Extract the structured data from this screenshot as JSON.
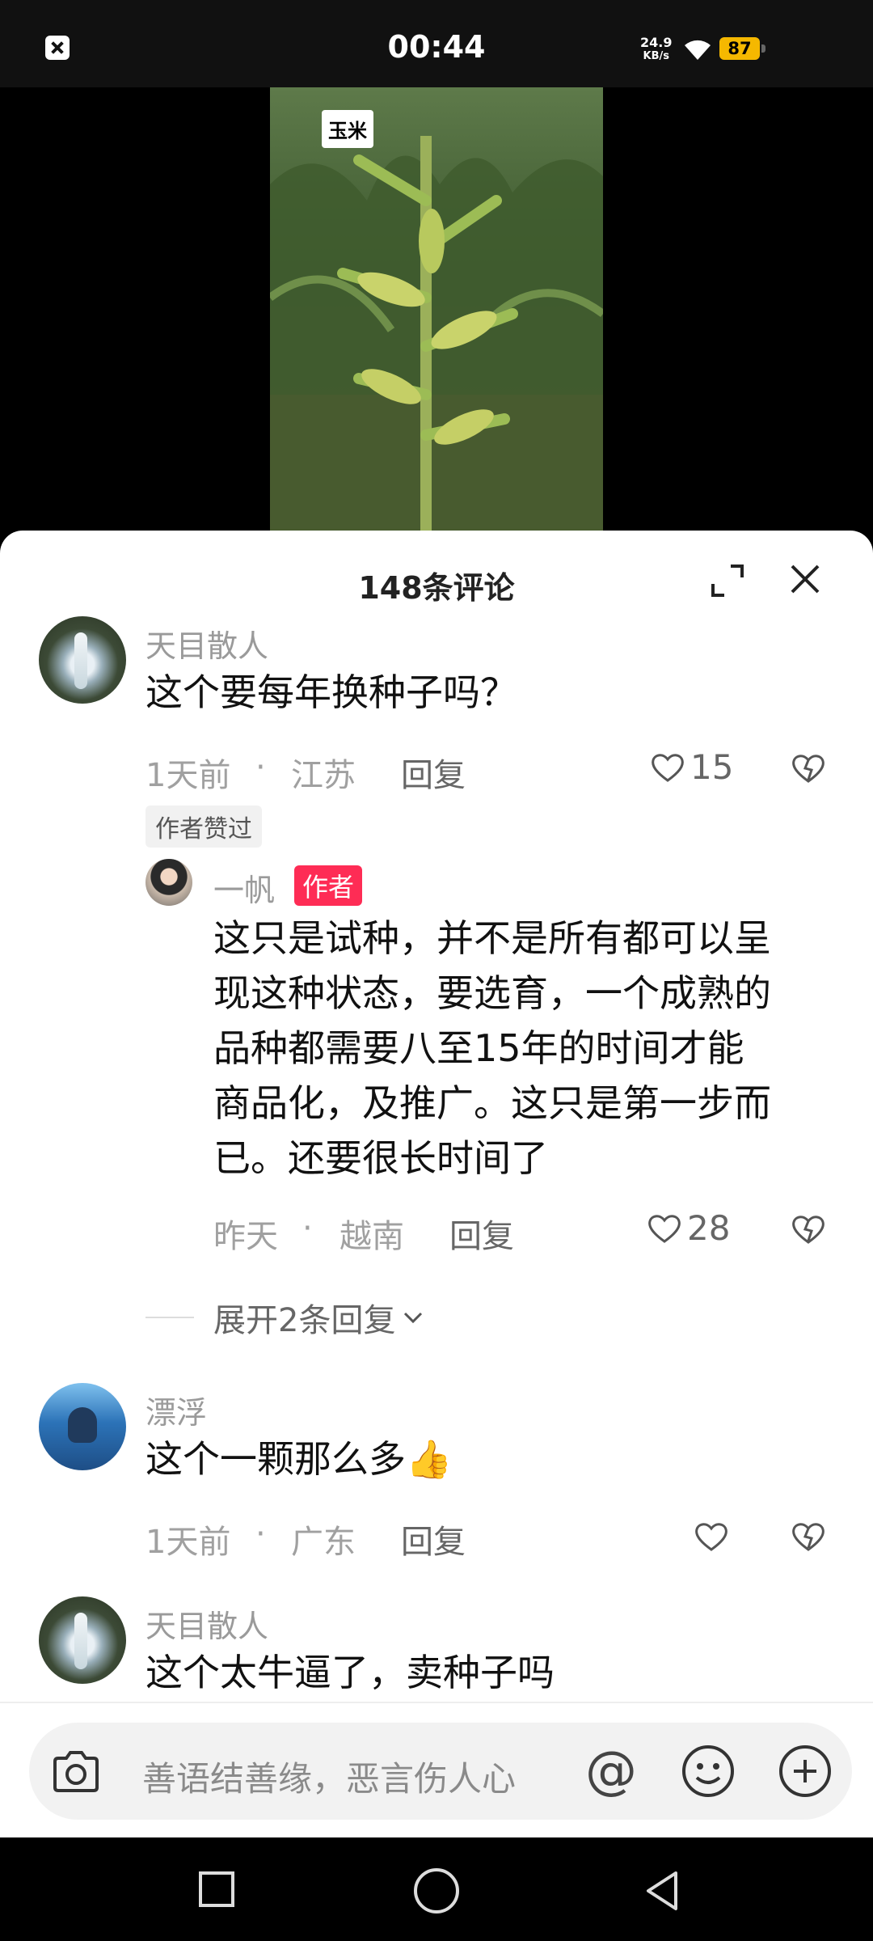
{
  "status_bar": {
    "time": "00:44",
    "net_speed_value": "24.9",
    "net_speed_unit": "KB/s",
    "battery": "87"
  },
  "video": {
    "tag": "玉米"
  },
  "sheet": {
    "title": "148条评论"
  },
  "comments": [
    {
      "user": "天目散人",
      "text": "这个要每年换种子吗？",
      "time": "1天前",
      "location": "江苏",
      "reply_label": "回复",
      "likes": "15",
      "badge": "作者赞过",
      "reply": {
        "user": "一帆",
        "role_badge": "作者",
        "lines": [
          "这只是试种，并不是所有都可以呈",
          "现这种状态，要选育，一个成熟的",
          "品种都需要八至15年的时间才能",
          "商品化，及推广。这只是第一步而",
          "已。还要很长时间了"
        ],
        "time": "昨天",
        "location": "越南",
        "reply_label": "回复",
        "likes": "28"
      },
      "expand_label": "展开2条回复"
    },
    {
      "user": "漂浮",
      "text": "这个一颗那么多👍",
      "time": "1天前",
      "location": "广东",
      "reply_label": "回复"
    },
    {
      "user": "天目散人",
      "text": "这个太牛逼了，卖种子吗"
    }
  ],
  "meta_separator": "·",
  "input": {
    "placeholder": "善语结善缘，恶言伤人心",
    "at_symbol": "@"
  },
  "icons": {
    "accent": "#fe2c55",
    "battery_color": "#f5b800"
  }
}
